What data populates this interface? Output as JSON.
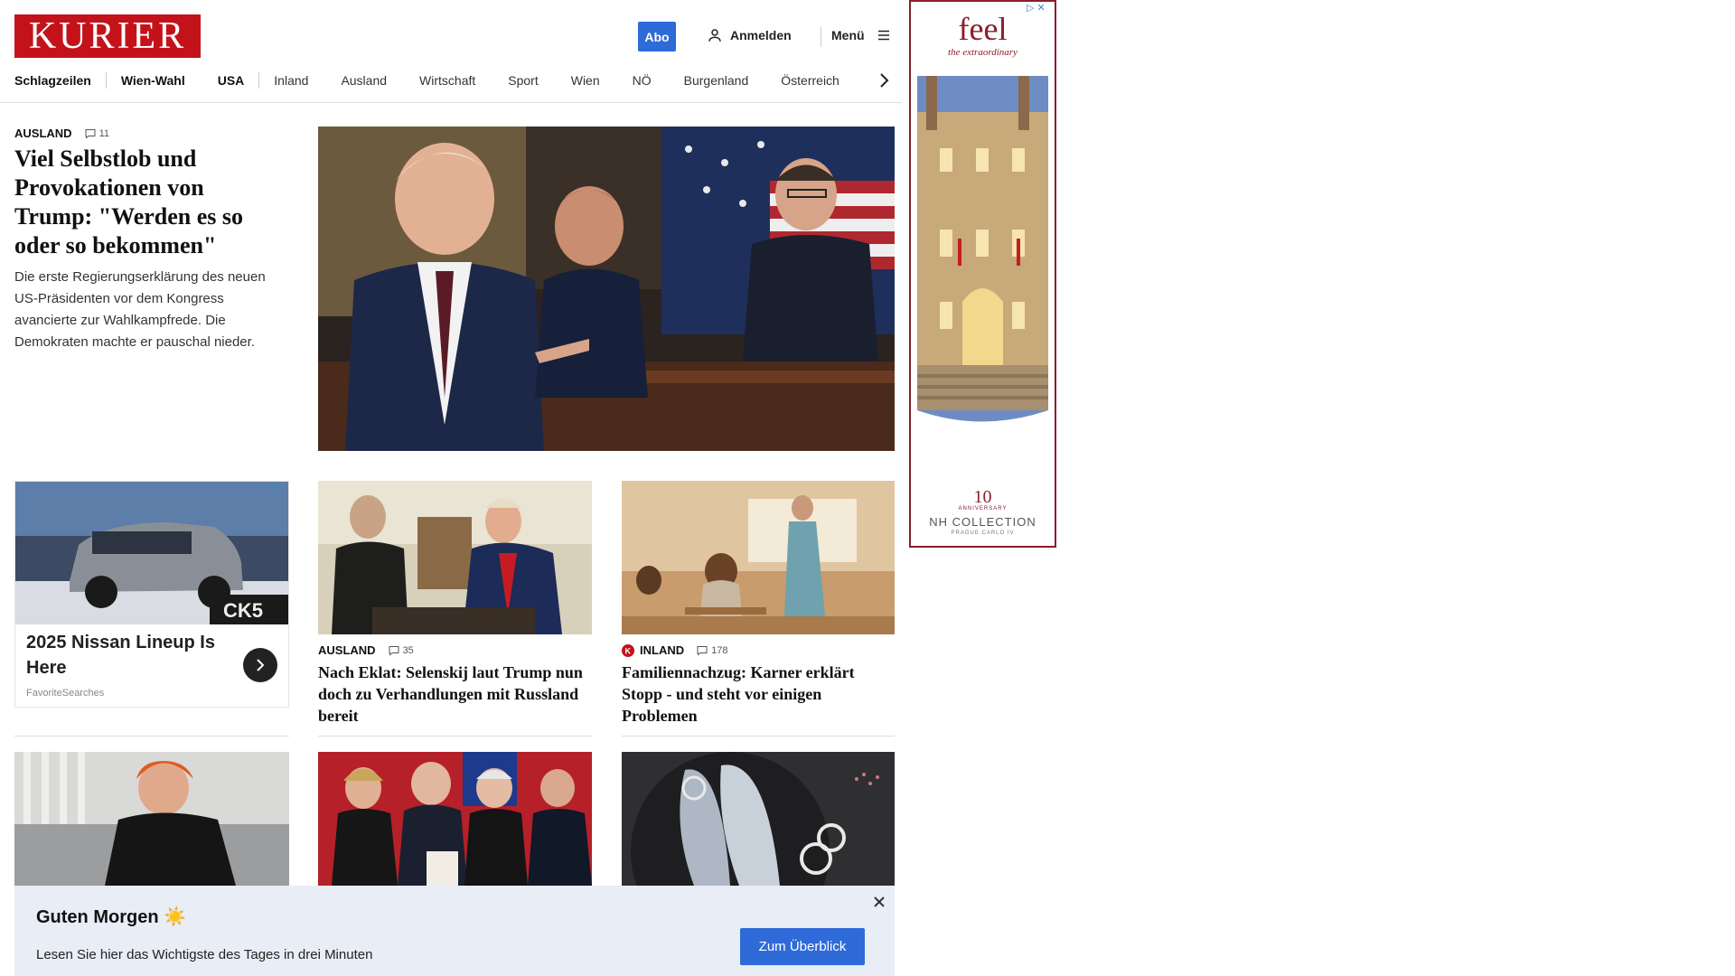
{
  "header": {
    "logo": "KURIER",
    "abo_label": "Abo",
    "login_label": "Anmelden",
    "menu_label": "Menü"
  },
  "nav": {
    "items": [
      "Schlagzeilen",
      "Wien-Wahl",
      "USA",
      "Inland",
      "Ausland",
      "Wirtschaft",
      "Sport",
      "Wien",
      "NÖ",
      "Burgenland",
      "Österreich"
    ]
  },
  "lead": {
    "kicker": "AUSLAND",
    "comments": "11",
    "title": "Viel Selbstlob und Provokationen von Trump: \"Werden es so oder so bekommen\"",
    "teaser": "Die erste Regierungserklärung des neuen US-Präsidenten vor dem Kongress avancierte zur Wahlkampfrede. Die Demokraten machte er pauschal nieder."
  },
  "ad_card": {
    "title": "2025 Nissan Lineup Is Here",
    "source": "FavoriteSearches"
  },
  "cards": [
    {
      "kicker": "AUSLAND",
      "comments": "35",
      "title": "Nach Eklat: Selenskij laut Trump nun doch zu Verhandlungen mit Russland bereit"
    },
    {
      "kicker": "INLAND",
      "comments": "178",
      "title": "Familiennachzug: Karner erklärt Stopp - und steht vor einigen Problemen"
    }
  ],
  "side_ad": {
    "headline": "feel",
    "tagline": "the extraordinary",
    "anniversary_number": "10",
    "anniversary_label": "ANNIVERSARY",
    "collection": "NH COLLECTION",
    "location": "PRAGUE CARLO IV"
  },
  "banner": {
    "title": "Guten Morgen ☀️",
    "text": "Lesen Sie hier das Wichtigste des Tages in drei Minuten",
    "button_label": "Zum Überblick"
  }
}
